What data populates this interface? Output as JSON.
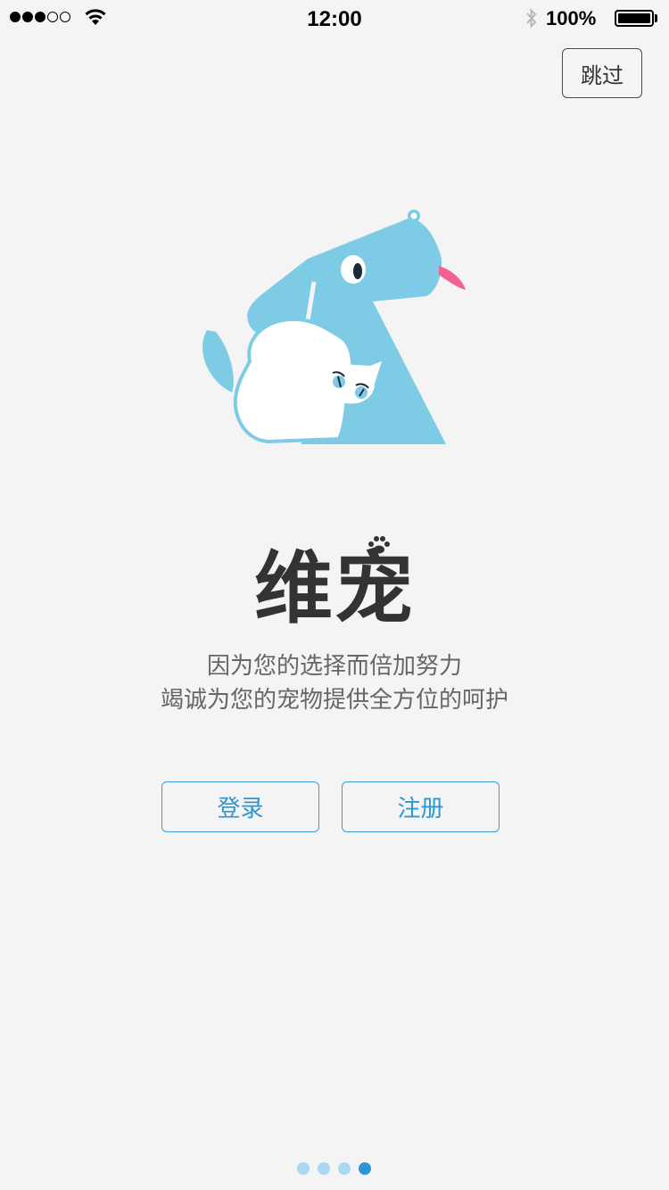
{
  "status_bar": {
    "time": "12:00",
    "battery": "100%",
    "signal_dots": [
      true,
      true,
      true,
      false,
      false
    ],
    "icons": [
      "signal-icon",
      "wifi-icon",
      "bluetooth-icon",
      "battery-icon"
    ]
  },
  "header": {
    "skip_label": "跳过"
  },
  "brand": {
    "logo_text": "维宠",
    "logo_color": "#333333",
    "accent_color": "#2f95d3",
    "illustration_color": "#7ecbe6"
  },
  "tagline": {
    "line1": "因为您的选择而倍加努力",
    "line2": "竭诚为您的宠物提供全方位的呵护"
  },
  "actions": {
    "login_label": "登录",
    "register_label": "注册"
  },
  "pager": {
    "total": 4,
    "current": 4
  }
}
